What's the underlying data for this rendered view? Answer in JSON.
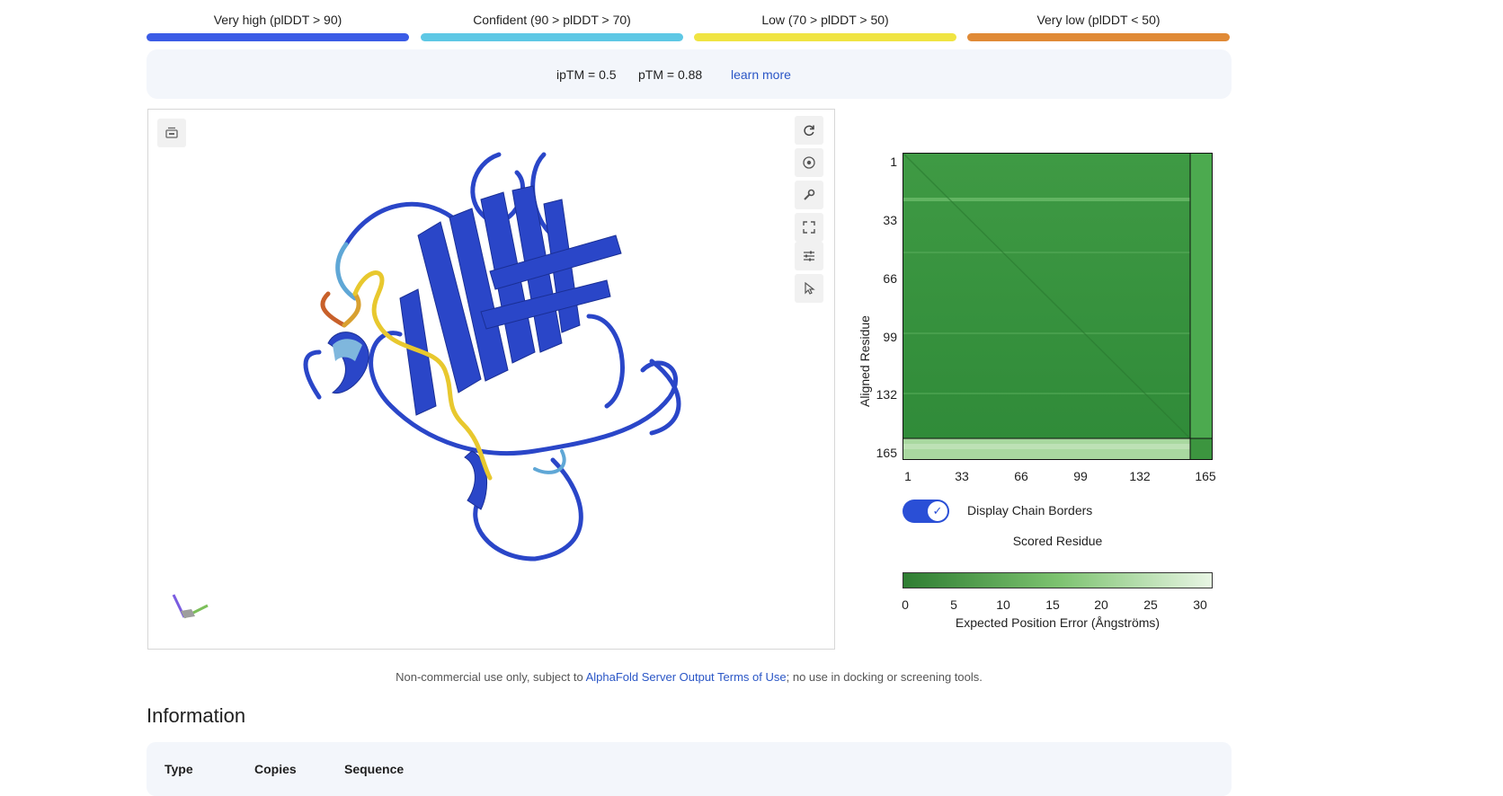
{
  "legend": {
    "items": [
      {
        "label": "Very high (plDDT > 90)",
        "color": "#3b5ce6"
      },
      {
        "label": "Confident (90 > plDDT > 70)",
        "color": "#5ec8e5"
      },
      {
        "label": "Low (70 > plDDT > 50)",
        "color": "#f0e442"
      },
      {
        "label": "Very low (plDDT < 50)",
        "color": "#e08a36"
      }
    ]
  },
  "metrics": {
    "iptm": "ipTM = 0.5",
    "ptm": "pTM = 0.88",
    "learn_more": "learn more"
  },
  "viewer": {
    "tools": [
      "refresh-icon",
      "target-icon",
      "wrench-icon",
      "fullscreen-icon",
      "sliders-icon",
      "pointer-icon"
    ],
    "top_left_tool": "layers-icon"
  },
  "pae": {
    "y_label": "Aligned Residue",
    "x_label": "Scored Residue",
    "y_ticks": [
      "1",
      "33",
      "66",
      "99",
      "132",
      "165"
    ],
    "x_ticks": [
      "1",
      "33",
      "66",
      "99",
      "132",
      "165"
    ],
    "toggle_label": "Display Chain Borders",
    "toggle_on": true,
    "colorbar_ticks": [
      "0",
      "5",
      "10",
      "15",
      "20",
      "25",
      "30"
    ],
    "colorbar_label": "Expected Position Error (Ångströms)",
    "colors": {
      "low": "#2e7d32",
      "high": "#e8f5e4"
    }
  },
  "footer": {
    "prefix": "Non-commercial use only, subject to ",
    "link": "AlphaFold Server Output Terms of Use",
    "suffix": "; no use in docking or screening tools."
  },
  "information": {
    "heading": "Information",
    "columns": [
      "Type",
      "Copies",
      "Sequence"
    ]
  }
}
